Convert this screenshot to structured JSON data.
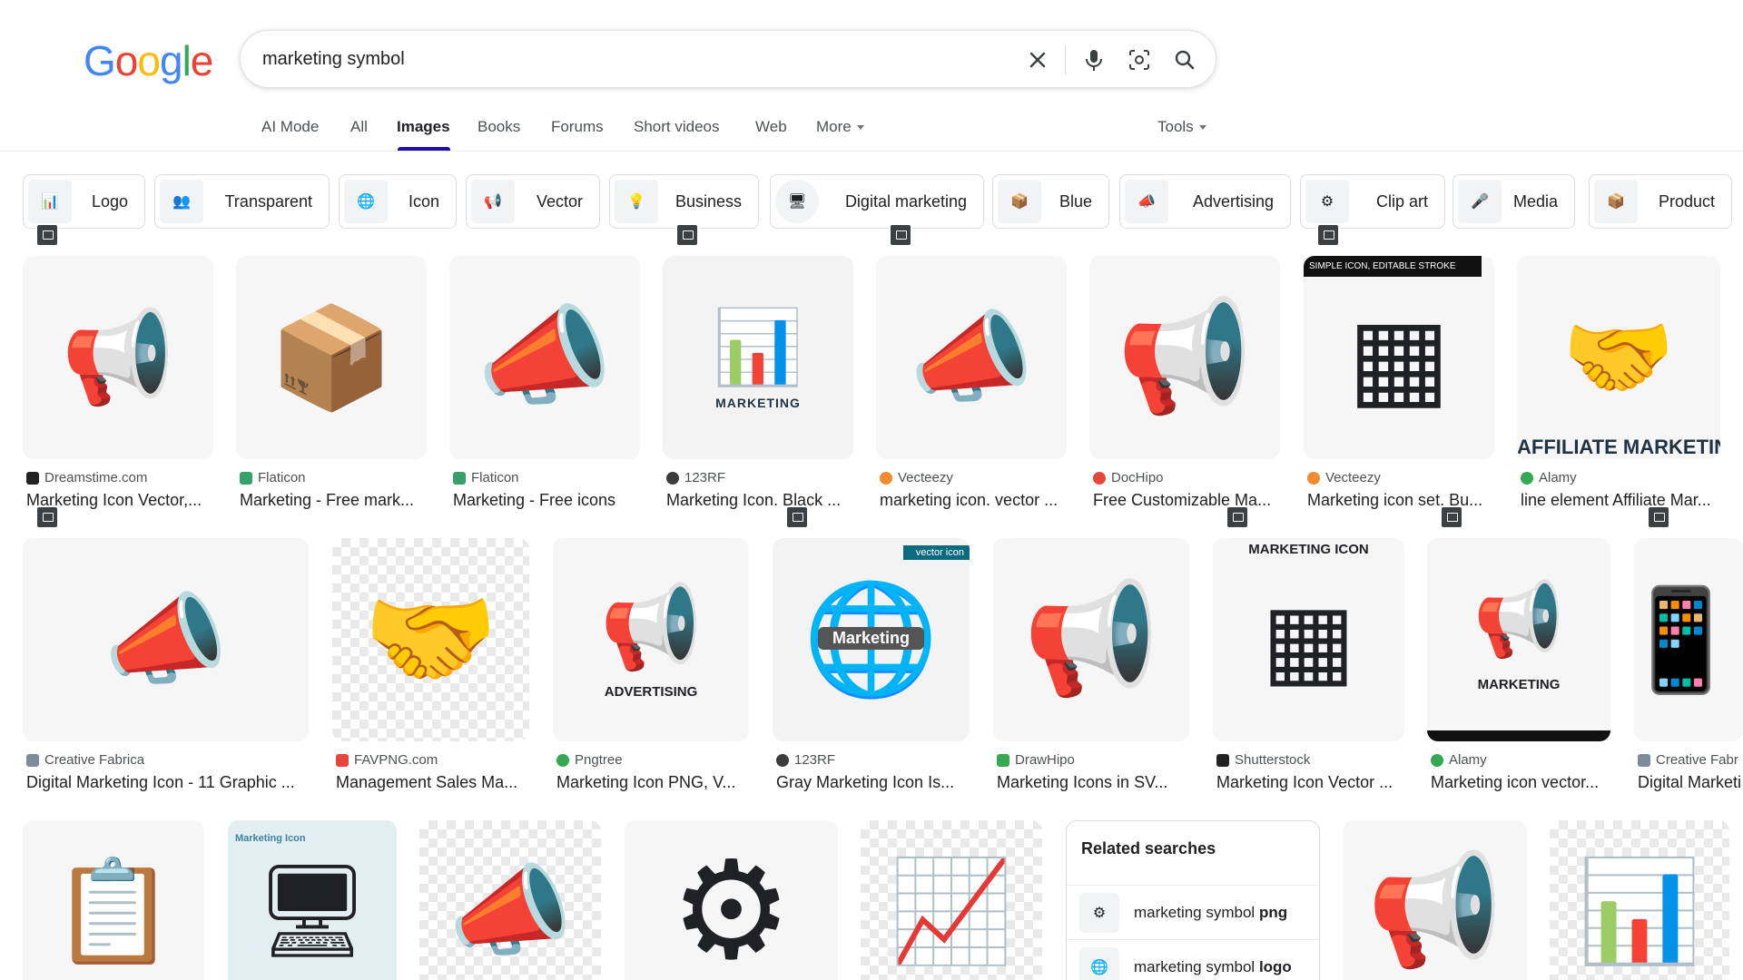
{
  "logo": {
    "letters": [
      "G",
      "o",
      "o",
      "g",
      "l",
      "e"
    ]
  },
  "search": {
    "query": "marketing symbol"
  },
  "tabs": [
    {
      "label": "AI Mode"
    },
    {
      "label": "All"
    },
    {
      "label": "Images"
    },
    {
      "label": "Books"
    },
    {
      "label": "Forums"
    },
    {
      "label": "Short videos"
    },
    {
      "label": "Web"
    },
    {
      "label": "More"
    }
  ],
  "tools": {
    "label": "Tools"
  },
  "chips": [
    {
      "label": "Logo"
    },
    {
      "label": "Transparent"
    },
    {
      "label": "Icon"
    },
    {
      "label": "Vector"
    },
    {
      "label": "Business"
    },
    {
      "label": "Digital marketing"
    },
    {
      "label": "Blue"
    },
    {
      "label": "Advertising"
    },
    {
      "label": "Clip art"
    },
    {
      "label": "Media"
    },
    {
      "label": "Product"
    }
  ],
  "row1": [
    {
      "source": "Dreamstime.com",
      "title": "Marketing Icon Vector,...",
      "fav": "#222222",
      "glyph": "📢"
    },
    {
      "source": "Flaticon",
      "title": "Marketing - Free mark...",
      "fav": "#38a169",
      "glyph": "📦"
    },
    {
      "source": "Flaticon",
      "title": "Marketing - Free icons",
      "fav": "#38a169",
      "glyph": "📣"
    },
    {
      "source": "123RF",
      "title": "Marketing Icon. Black ...",
      "fav": "#3c3c3c",
      "glyph": "📊",
      "caption": "MARKETING"
    },
    {
      "source": "Vecteezy",
      "title": "marketing icon. vector ...",
      "fav": "#f28b30",
      "glyph": "📣"
    },
    {
      "source": "DocHipo",
      "title": "Free Customizable Ma...",
      "fav": "#e8453c",
      "glyph": "📢"
    },
    {
      "source": "Vecteezy",
      "title": "Marketing icon set. Bu...",
      "fav": "#f28b30",
      "glyph": "▦",
      "caption": "SIMPLE ICON, EDITABLE STROKE"
    },
    {
      "source": "Alamy",
      "title": "line element Affiliate Mar...",
      "fav": "#34a853",
      "glyph": "🤝",
      "caption": "AFFILIATE MARKETING"
    }
  ],
  "row2": [
    {
      "source": "Creative Fabrica",
      "title": "Digital Marketing Icon - 11 Graphic ...",
      "fav": "#7b8c9c",
      "glyph": "📣"
    },
    {
      "source": "FAVPNG.com",
      "title": "Management Sales Ma...",
      "fav": "#e8453c",
      "glyph": "🤝"
    },
    {
      "source": "Pngtree",
      "title": "Marketing Icon PNG, V...",
      "fav": "#34a853",
      "glyph": "📢",
      "caption": "ADVERTISING"
    },
    {
      "source": "123RF",
      "title": "Gray Marketing Icon Is...",
      "fav": "#3c3c3c",
      "glyph": "🌐",
      "caption": "Marketing",
      "corner": "vector icon"
    },
    {
      "source": "DrawHipo",
      "title": "Marketing Icons in SV...",
      "fav": "#34a853",
      "glyph": "📢"
    },
    {
      "source": "Shutterstock",
      "title": "Marketing Icon Vector ...",
      "fav": "#222222",
      "glyph": "▦",
      "caption": "MARKETING ICON"
    },
    {
      "source": "Alamy",
      "title": "Marketing icon vector...",
      "fav": "#34a853",
      "glyph": "📢",
      "caption": "MARKETING"
    },
    {
      "source": "Creative Fabr",
      "title": "Digital Marketi",
      "fav": "#7b8c9c",
      "glyph": "📱"
    }
  ],
  "row3": [
    {
      "glyph": "📋"
    },
    {
      "glyph": "🖥",
      "caption": "Marketing Icon"
    },
    {
      "glyph": "📣"
    },
    {
      "glyph": "⚙"
    },
    {
      "glyph": "📈"
    },
    {
      "glyph": "📢"
    },
    {
      "glyph": "📊"
    }
  ],
  "related": {
    "title": "Related searches",
    "items": [
      {
        "prefix": "marketing symbol ",
        "bold": "png"
      },
      {
        "prefix": "marketing symbol ",
        "bold": "logo"
      }
    ]
  }
}
